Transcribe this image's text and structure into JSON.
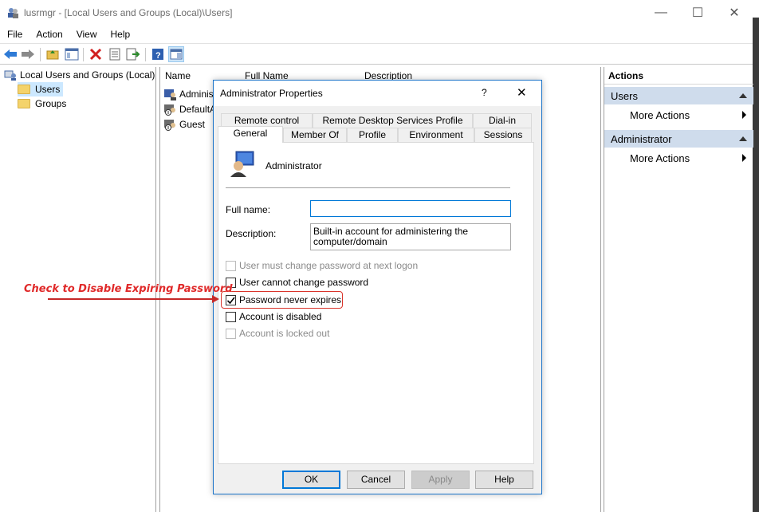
{
  "window": {
    "title": "lusrmgr - [Local Users and Groups (Local)\\Users]"
  },
  "caption_buttons": {
    "minimize": "—",
    "maximize": "☐",
    "close": "✕"
  },
  "menu": [
    "File",
    "Action",
    "View",
    "Help"
  ],
  "tree": {
    "root": "Local Users and Groups (Local)",
    "items": [
      "Users",
      "Groups"
    ]
  },
  "list": {
    "columns": [
      "Name",
      "Full Name",
      "Description"
    ],
    "rows": [
      "Adminis",
      "DefaultA",
      "Guest"
    ]
  },
  "actions": {
    "header": "Actions",
    "sections": [
      {
        "title": "Users",
        "item": "More Actions"
      },
      {
        "title": "Administrator",
        "item": "More Actions"
      }
    ]
  },
  "dialog": {
    "title": "Administrator Properties",
    "help_glyph": "?",
    "tabs_row1": [
      "Remote control",
      "Remote Desktop Services Profile",
      "Dial-in"
    ],
    "tabs_row2": [
      "General",
      "Member Of",
      "Profile",
      "Environment",
      "Sessions"
    ],
    "selected_tab": "General",
    "user_name": "Administrator",
    "full_name_label": "Full name:",
    "full_name_value": "",
    "description_label": "Description:",
    "description_value_line1": "Built-in account for administering the",
    "description_value_line2": "computer/domain",
    "checkboxes": [
      {
        "label": "User must change password at next logon",
        "checked": false,
        "disabled": true
      },
      {
        "label": "User cannot change password",
        "checked": false,
        "disabled": false
      },
      {
        "label": "Password never expires",
        "checked": true,
        "disabled": false
      },
      {
        "label": "Account is disabled",
        "checked": false,
        "disabled": false
      },
      {
        "label": "Account is locked out",
        "checked": false,
        "disabled": true
      }
    ],
    "buttons": {
      "ok": "OK",
      "cancel": "Cancel",
      "apply": "Apply",
      "help": "Help"
    }
  },
  "annotation": {
    "text": "Check to Disable Expiring Password",
    "color": "#e02a2a"
  },
  "colors": {
    "accent": "#0078d7",
    "actions_section_bg": "#cfdcec",
    "annotation": "#e02a2a"
  }
}
